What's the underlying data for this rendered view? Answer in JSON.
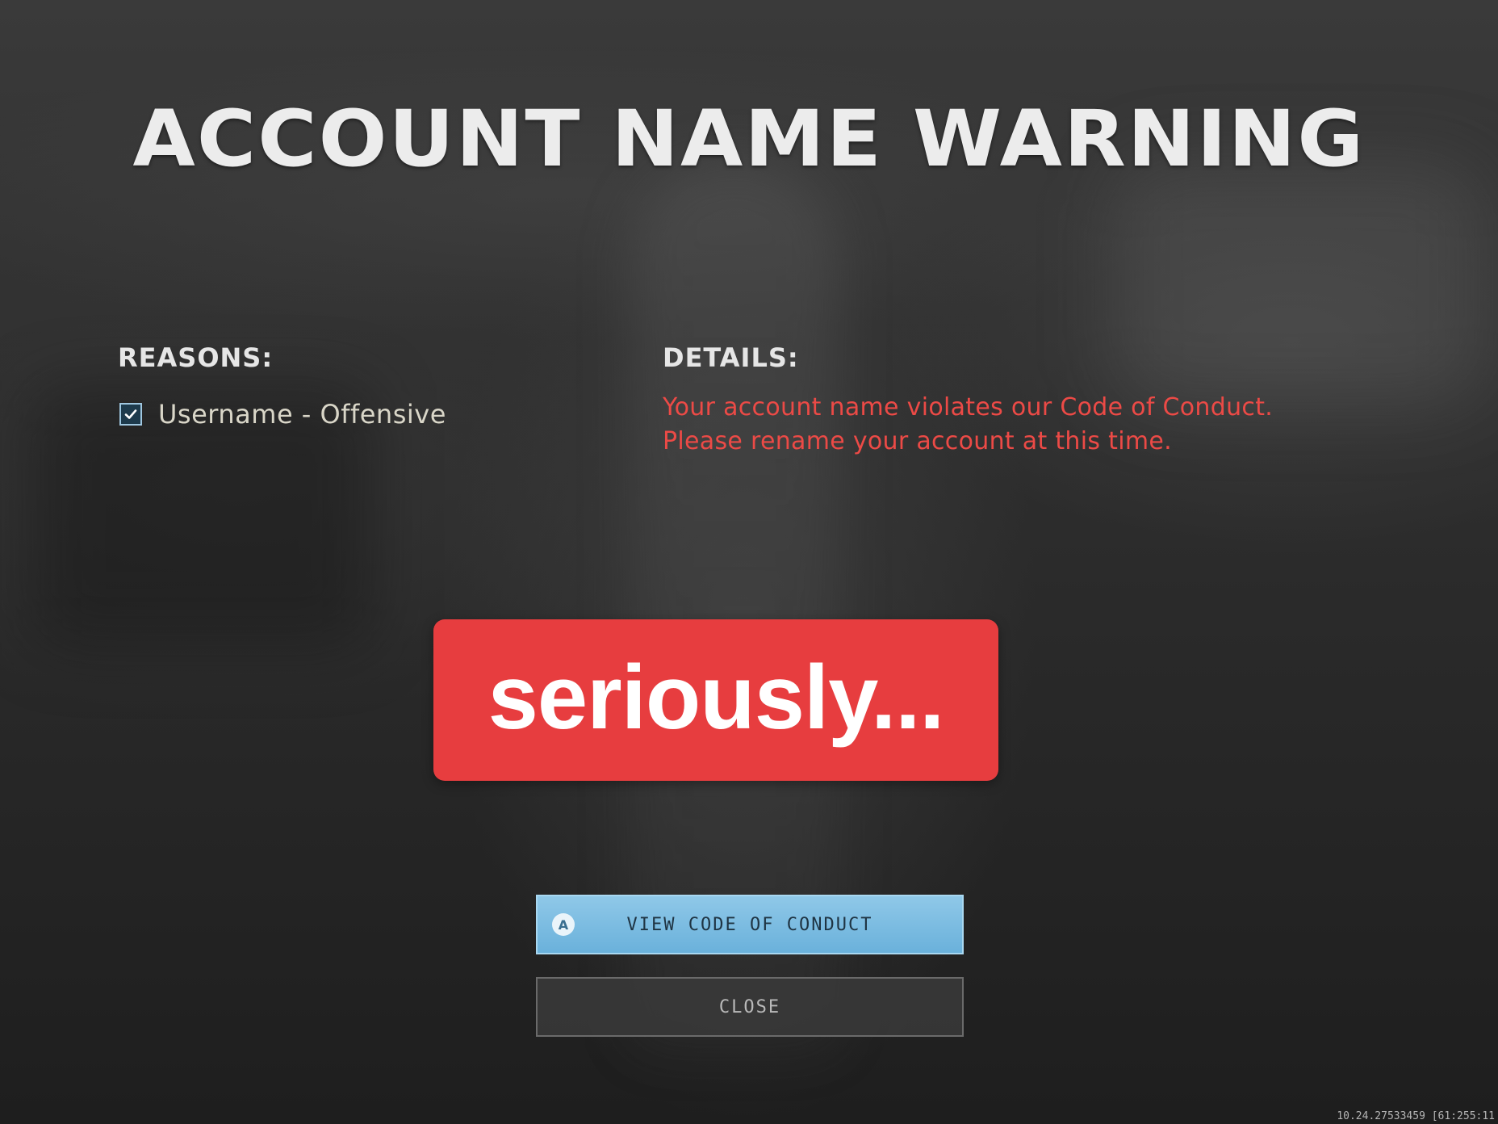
{
  "dialog": {
    "title": "ACCOUNT NAME WARNING",
    "reasons_label": "REASONS:",
    "details_label": "DETAILS:",
    "reasons": [
      {
        "label": "Username - Offensive",
        "checked": true
      }
    ],
    "details_text": "Your account name violates our Code of Conduct. Please rename your account at this time."
  },
  "overlay": {
    "text": "seriously...",
    "background_color": "#e73d3f"
  },
  "buttons": {
    "view_code": {
      "label": "VIEW CODE OF CONDUCT",
      "key_hint": "A"
    },
    "close": {
      "label": "CLOSE"
    }
  },
  "footer": {
    "build_info": "10.24.27533459 [61:255:11"
  },
  "colors": {
    "details_text": "#ec4a46",
    "primary_button": "#7fbfe3",
    "title_text": "#ececec"
  },
  "icons": {
    "checkbox": "checkmark-icon",
    "controller_button": "controller-a-button-icon"
  }
}
